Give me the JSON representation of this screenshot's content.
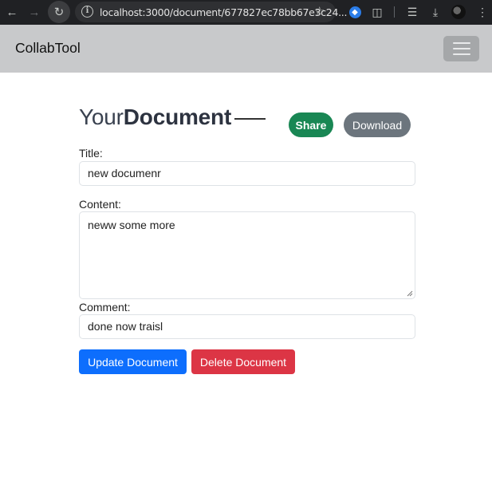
{
  "browser": {
    "url": "localhost:3000/document/677827ec78bb67e3c24...",
    "back_icon": "arrow-left-icon",
    "forward_icon": "arrow-right-icon",
    "reload_icon": "reload-icon"
  },
  "navbar": {
    "brand": "CollabTool",
    "toggler_icon": "hamburger-icon"
  },
  "document": {
    "heading_light": "Your",
    "heading_bold": "Document",
    "share_label": "Share",
    "download_label": "Download",
    "title_label": "Title:",
    "title_value": "new documenr",
    "content_label": "Content:",
    "content_value": "neww some more",
    "comment_label": "Comment:",
    "comment_value": "done now traisl",
    "update_label": "Update Document",
    "delete_label": "Delete Document"
  },
  "colors": {
    "share": "#198754",
    "download": "#6c757d",
    "update": "#0d6efd",
    "delete": "#dc3545",
    "navbar": "#c8c9cb"
  }
}
